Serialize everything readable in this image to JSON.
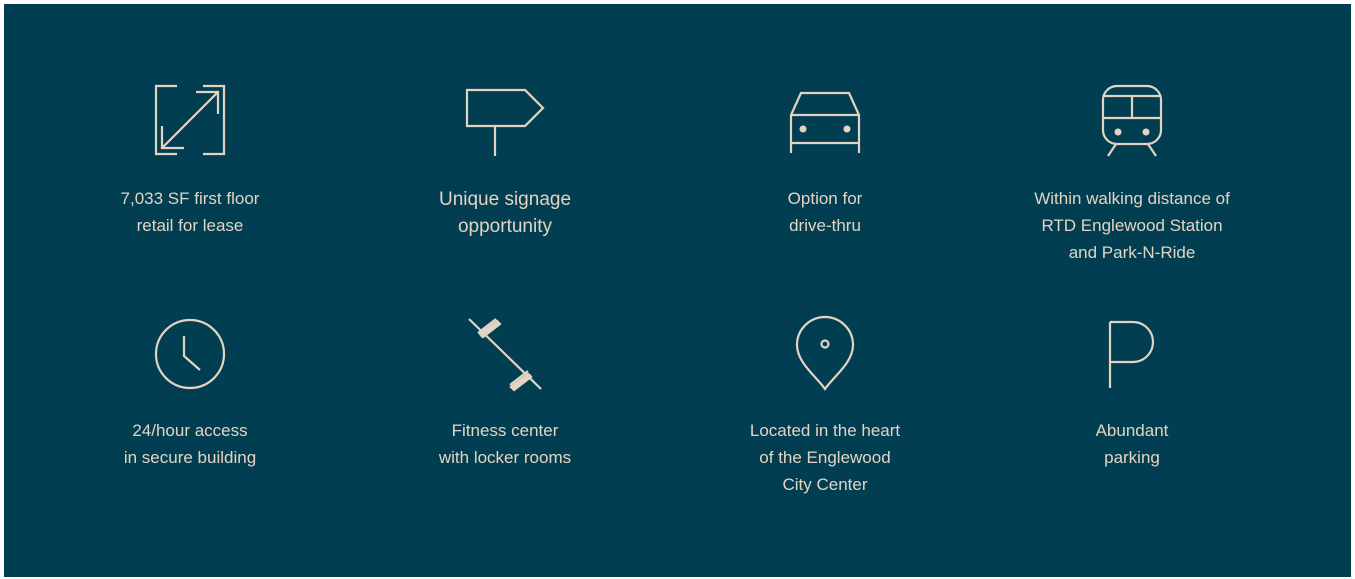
{
  "colors": {
    "background": "#023e51",
    "accent": "#e3d3c2",
    "page_border": "#ffffff"
  },
  "features": [
    {
      "icon": "expand-arrows-icon",
      "label": "7,033 SF first floor\nretail for lease"
    },
    {
      "icon": "signpost-icon",
      "label": "Unique signage\nopportunity"
    },
    {
      "icon": "car-icon",
      "label": "Option for\ndrive-thru"
    },
    {
      "icon": "train-icon",
      "label": "Within walking distance of\nRTD Englewood Station\nand Park-N-Ride"
    },
    {
      "icon": "clock-icon",
      "label": "24/hour access\nin secure building"
    },
    {
      "icon": "dumbbell-icon",
      "label": "Fitness center\nwith locker rooms"
    },
    {
      "icon": "location-pin-icon",
      "label": "Located in the heart\nof the Englewood\nCity Center"
    },
    {
      "icon": "parking-icon",
      "label": "Abundant\nparking"
    }
  ]
}
